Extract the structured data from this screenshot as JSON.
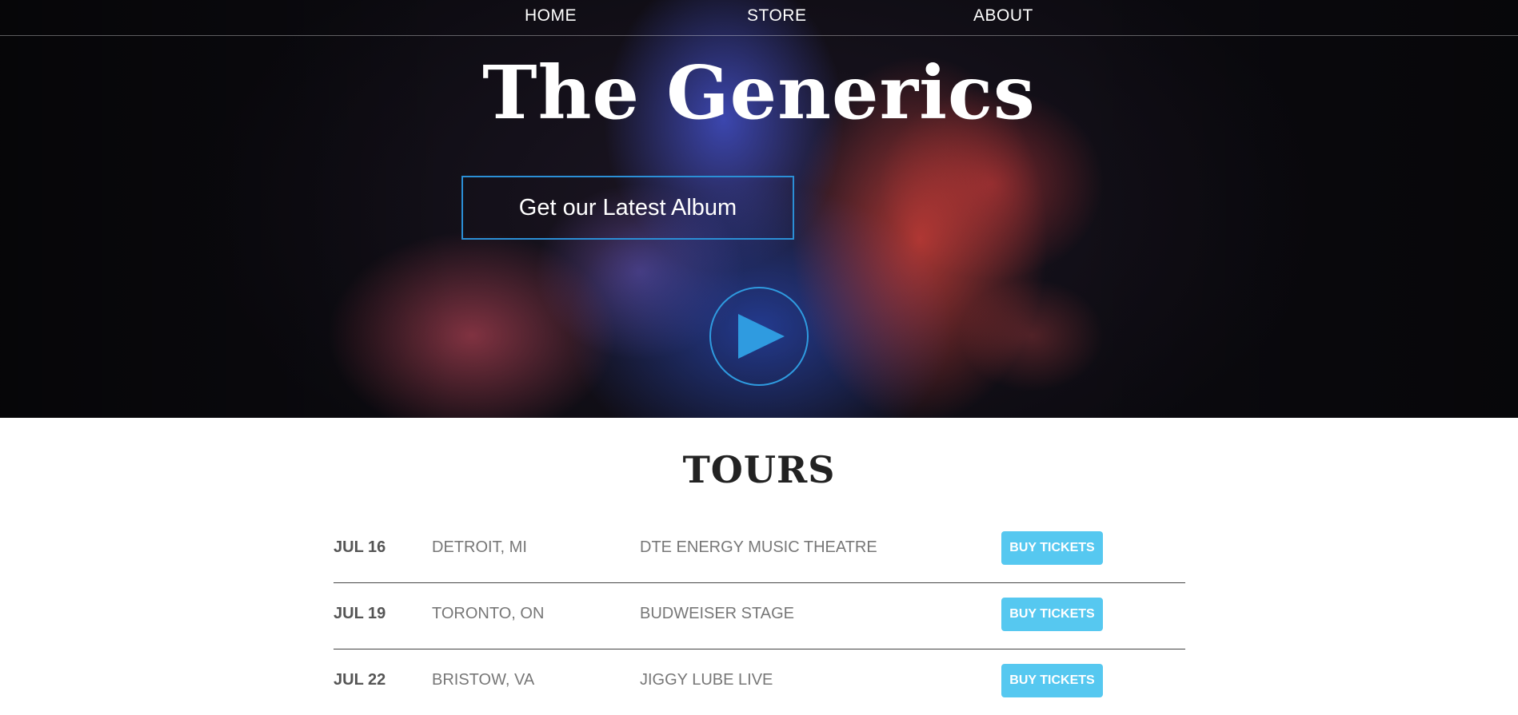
{
  "nav": {
    "items": [
      {
        "label": "HOME"
      },
      {
        "label": "STORE"
      },
      {
        "label": "ABOUT"
      }
    ]
  },
  "hero": {
    "title": "The Generics",
    "album_button": "Get our Latest Album",
    "play_icon": "play-icon"
  },
  "tours": {
    "title": "TOURS",
    "rows": [
      {
        "date": "JUL 16",
        "city": "DETROIT, MI",
        "venue": "DTE ENERGY MUSIC THEATRE",
        "button": "BUY TICKETS"
      },
      {
        "date": "JUL 19",
        "city": "TORONTO, ON",
        "venue": "BUDWEISER STAGE",
        "button": "BUY TICKETS"
      },
      {
        "date": "JUL 22",
        "city": "BRISTOW, VA",
        "venue": "JIGGY LUBE LIVE",
        "button": "BUY TICKETS"
      }
    ]
  },
  "colors": {
    "accent_border": "#2b8fd6",
    "play_color": "#2f9be0",
    "buy_button": "#56c8f0"
  }
}
